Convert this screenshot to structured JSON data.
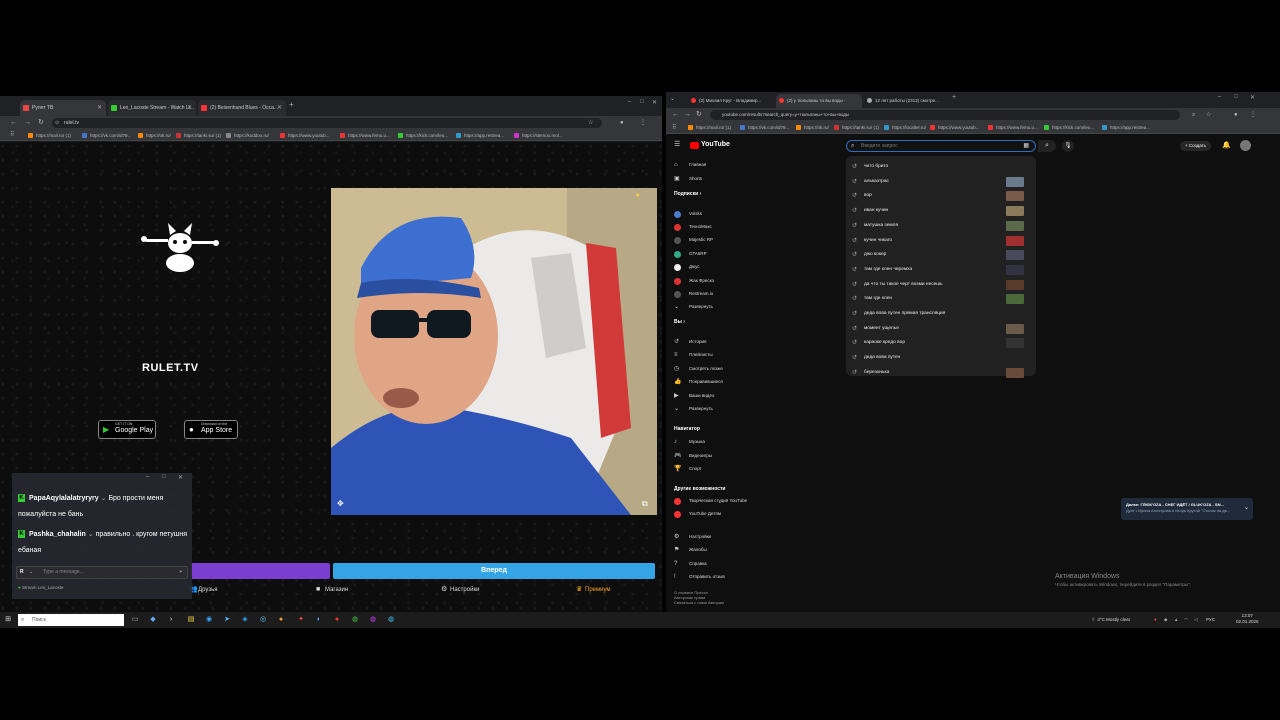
{
  "left_browser": {
    "tabs": [
      {
        "label": "Рулет ТВ",
        "color": "#e44"
      },
      {
        "label": "Leo_Lacoste Stream - Watch Li...",
        "color": "#3c3"
      },
      {
        "label": "(2) Beisenhund Blues - Осса...",
        "color": "#f33"
      }
    ],
    "url": "rulet.tv",
    "bookmarks": [
      "https://mail.ru/ (1)",
      "https://vk.com/id79...",
      "https://ok.ru/",
      "https://tanki.su/ (1)",
      "https://koddoo.ru/",
      "https://www.youtub...",
      "https://www.femu.u...",
      "https://kick.com/leo...",
      "https://app.restrea...",
      "https://stemoo.mol..."
    ],
    "site": {
      "logo_text": "RULET.TV",
      "google_play": {
        "small": "GET IT ON",
        "label": "Google Play"
      },
      "app_store": {
        "small": "Download on the",
        "label": "App Store"
      },
      "blue_button": "Вперед",
      "menu": [
        {
          "label": "Друзья",
          "icon": "users-icon"
        },
        {
          "label": "Магазин",
          "icon": "shop-icon"
        },
        {
          "label": "Настройки",
          "icon": "gear-icon"
        },
        {
          "label": "Премиум",
          "icon": "premium-icon"
        }
      ]
    }
  },
  "chat": {
    "messages": [
      {
        "user": "PapaAqylalalatryryry",
        "text": "Бро прости меня пожалуйста не бань"
      },
      {
        "user": "Pashka_chahalin",
        "text": "правильно . кругом петушня ебаная"
      }
    ],
    "placeholder": "Type a message...",
    "footer": "Stream Leo_Lacoste"
  },
  "right_browser": {
    "tabs": [
      {
        "label": "(2) Михаил Круг - Владимир..."
      },
      {
        "label": "(2) у тюльпаны то вы воды -"
      },
      {
        "label": "12 лет работы (2313) смотре..."
      }
    ],
    "url": "youtube.com/results?search_query=у+тюльпаны+то+вы+воды",
    "bookmarks": [
      "https://mail.ru/ (1)",
      "https://vk.com/id79...",
      "https://ok.ru/",
      "https://tanki.su/ (1)",
      "https://localtel.ru/",
      "https://www.youtub...",
      "https://www.femu.u...",
      "https://kick.com/leo...",
      "https://app.restrea..."
    ]
  },
  "youtube": {
    "logo": "YouTube",
    "search_placeholder": "Введите запрос",
    "create_label": "Создать",
    "sidebar": {
      "main": [
        {
          "label": "Главная",
          "icon": "home-icon"
        },
        {
          "label": "Shorts",
          "icon": "shorts-icon"
        }
      ],
      "subs_title": "Подписки",
      "subs": [
        {
          "label": "Volsks",
          "color": "#4a7bd0"
        },
        {
          "label": "ТехноМакс",
          "color": "#d33"
        },
        {
          "label": "Majestic RP",
          "color": "#555"
        },
        {
          "label": "GTA5RP",
          "color": "#3a8"
        },
        {
          "label": "Джус",
          "color": "#eee"
        },
        {
          "label": "Жак Фреско",
          "color": "#d33"
        },
        {
          "label": "Restream.io",
          "color": "#555"
        }
      ],
      "expand": "Развернуть",
      "you_title": "Вы",
      "you": [
        {
          "label": "История",
          "icon": "history-icon"
        },
        {
          "label": "Плейлисты",
          "icon": "playlist-icon"
        },
        {
          "label": "Смотреть позже",
          "icon": "clock-icon"
        },
        {
          "label": "Понравившиеся",
          "icon": "like-icon"
        },
        {
          "label": "Ваши видео",
          "icon": "video-icon"
        },
        {
          "label": "Развернуть",
          "icon": "chevron-down-icon"
        }
      ],
      "nav_title": "Навигатор",
      "nav": [
        {
          "label": "Музыка",
          "icon": "music-icon"
        },
        {
          "label": "Видеоигры",
          "icon": "gamepad-icon"
        },
        {
          "label": "Спорт",
          "icon": "trophy-icon"
        }
      ],
      "other_title": "Другие возможности",
      "other": [
        {
          "label": "Творческая студия YouTube",
          "color": "#f33"
        },
        {
          "label": "YouTube Детям",
          "color": "#f33"
        }
      ],
      "settings": [
        {
          "label": "Настройки",
          "icon": "gear-icon"
        },
        {
          "label": "Жалобы",
          "icon": "flag-icon"
        },
        {
          "label": "Справка",
          "icon": "help-icon"
        },
        {
          "label": "Отправить отзыв",
          "icon": "feedback-icon"
        }
      ],
      "footer": [
        "О сервисе  Прессе",
        "Авторские права",
        "Связаться с нами  Авторам"
      ]
    },
    "suggestions": [
      {
        "text": "чито брито",
        "thumb": ""
      },
      {
        "text": "альказтрас",
        "thumb": "#6a7a8a"
      },
      {
        "text": "вор",
        "thumb": "#7a5a4a"
      },
      {
        "text": "иван кучин",
        "thumb": "#8a7a5a"
      },
      {
        "text": "матушка земля",
        "thumb": "#5a6a4a"
      },
      {
        "text": "кучин чикаго",
        "thumb": "#a03030"
      },
      {
        "text": "джо кокер",
        "thumb": "#4a4a5a"
      },
      {
        "text": "там где клен черемха",
        "thumb": "#334"
      },
      {
        "text": "да что ты такое черт возми несешь",
        "thumb": "#5a3a2a"
      },
      {
        "text": "там где клен",
        "thumb": "#4a6a3a"
      },
      {
        "text": "деда вова путен прямая трансляция",
        "thumb": ""
      },
      {
        "text": "момент ущелье",
        "thumb": "#6a5a4a"
      },
      {
        "text": "караоке кредо вор",
        "thumb": "#333"
      },
      {
        "text": "деда вова путен",
        "thumb": ""
      },
      {
        "text": "березонька",
        "thumb": "#6a4a3a"
      }
    ],
    "toast": {
      "title": "Далее: ГЛЮК'OZA - СНЕГ ИДЁТ / GLUK'OZA - SN...",
      "subtitle": "Дуэт • Ирина Аллегрова и Игорь Крутой \"Столик на дв..."
    },
    "activation": {
      "title": "Активация Windows",
      "text": "Чтобы активировать Windows, перейдите в раздел \"Параметры\"."
    }
  },
  "taskbar": {
    "search_placeholder": "Поиск",
    "weather": "3°C  Mostly clear",
    "lang": "РУС",
    "time": "13:07",
    "date": "02.01.2026"
  }
}
